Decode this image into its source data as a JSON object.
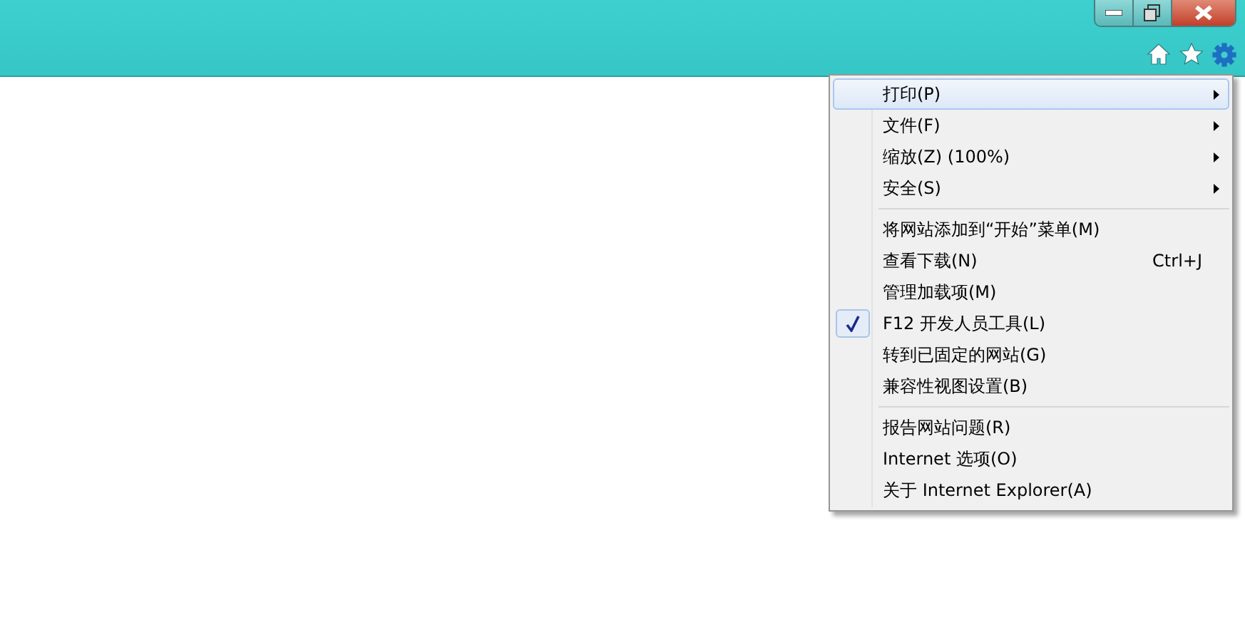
{
  "menu": {
    "groups": [
      {
        "items": [
          {
            "label": "打印(P)",
            "submenu": true,
            "checked": false,
            "selected": true
          },
          {
            "label": "文件(F)",
            "submenu": true,
            "checked": false,
            "selected": false
          },
          {
            "label": "缩放(Z) (100%)",
            "submenu": true,
            "checked": false,
            "selected": false
          },
          {
            "label": "安全(S)",
            "submenu": true,
            "checked": false,
            "selected": false
          }
        ]
      },
      {
        "items": [
          {
            "label": "将网站添加到“开始”菜单(M)",
            "submenu": false,
            "checked": false,
            "selected": false
          },
          {
            "label": "查看下载(N)",
            "shortcut": "Ctrl+J",
            "submenu": false,
            "checked": false,
            "selected": false
          },
          {
            "label": "管理加载项(M)",
            "submenu": false,
            "checked": false,
            "selected": false
          },
          {
            "label": "F12 开发人员工具(L)",
            "submenu": false,
            "checked": true,
            "selected": false
          },
          {
            "label": "转到已固定的网站(G)",
            "submenu": false,
            "checked": false,
            "selected": false
          },
          {
            "label": "兼容性视图设置(B)",
            "submenu": false,
            "checked": false,
            "selected": false
          }
        ]
      },
      {
        "items": [
          {
            "label": "报告网站问题(R)",
            "submenu": false,
            "checked": false,
            "selected": false
          },
          {
            "label": "Internet 选项(O)",
            "submenu": false,
            "checked": false,
            "selected": false
          },
          {
            "label": "关于 Internet Explorer(A)",
            "submenu": false,
            "checked": false,
            "selected": false
          }
        ]
      }
    ]
  }
}
